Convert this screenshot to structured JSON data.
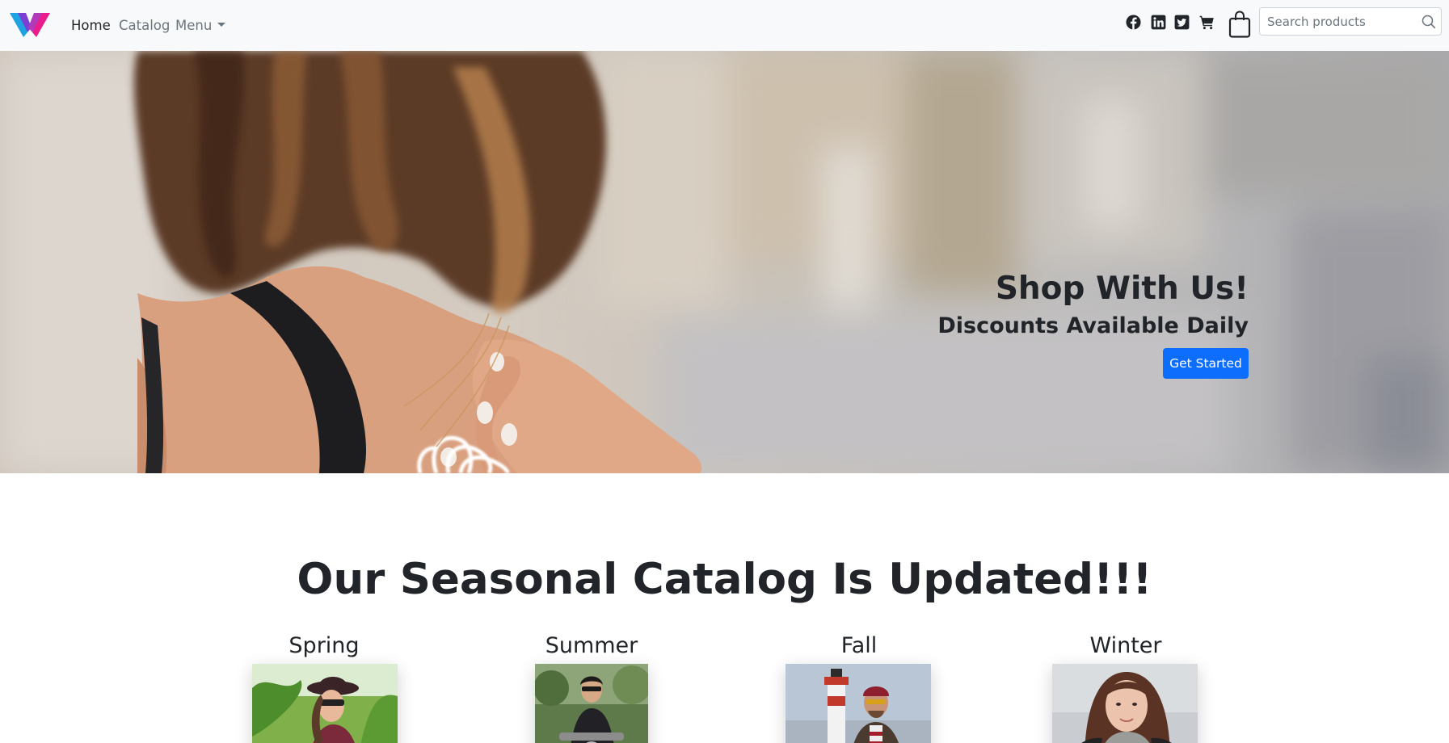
{
  "navbar": {
    "brand_icon": "brand-logo-icon",
    "links": [
      {
        "label": "Home",
        "active": true
      },
      {
        "label": "Catalog",
        "active": false
      },
      {
        "label": "Menu",
        "active": false,
        "has_dropdown": true
      }
    ],
    "icons": [
      "facebook-icon",
      "linkedin-icon",
      "twitter-icon",
      "cart-icon",
      "shopping-bag-icon"
    ],
    "search": {
      "placeholder": "Search products",
      "value": ""
    }
  },
  "hero": {
    "title": "Shop With Us!",
    "subtitle": "Discounts Available Daily",
    "cta_label": "Get Started",
    "cta_color": "#0d6efd"
  },
  "catalog": {
    "heading": "Our Seasonal Catalog Is Updated!!!",
    "seasons": [
      {
        "title": "Spring"
      },
      {
        "title": "Summer"
      },
      {
        "title": "Fall"
      },
      {
        "title": "Winter"
      }
    ]
  },
  "colors": {
    "navbar_bg": "#f8f9fa",
    "primary": "#0d6efd",
    "text": "#212529",
    "muted": "#6c757d",
    "logo_pink": "#e91e8c",
    "logo_blue": "#1fa3e0"
  }
}
